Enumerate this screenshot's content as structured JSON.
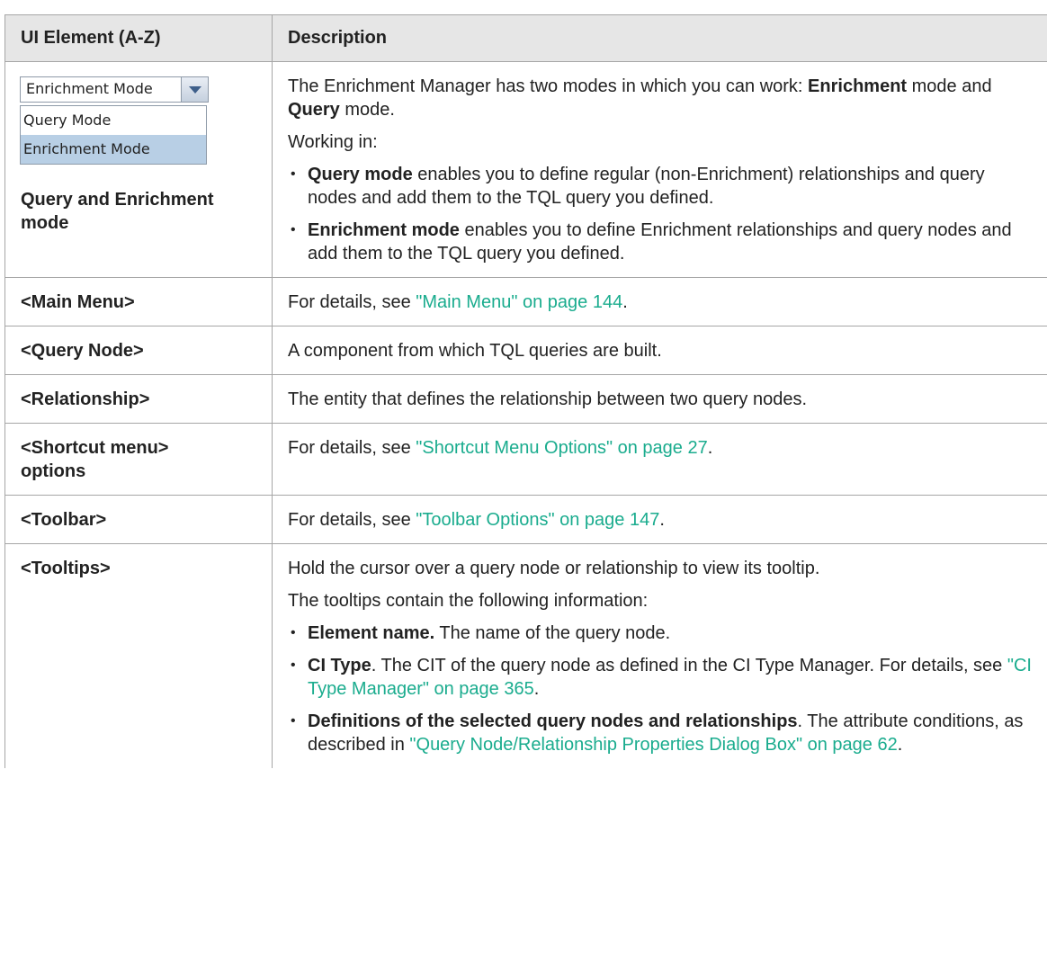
{
  "table": {
    "headers": [
      "UI Element (A-Z)",
      "Description"
    ],
    "dropdown": {
      "selected": "Enrichment Mode",
      "options": [
        "Query Mode",
        "Enrichment Mode"
      ]
    },
    "row1": {
      "name": "Query and Enrichment mode",
      "intro_pre": "The Enrichment Manager has two modes in which you can work: ",
      "intro_b1": "Enrichment",
      "intro_mid": " mode and ",
      "intro_b2": "Query",
      "intro_post": " mode.",
      "working": "Working in:",
      "b1_bold": "Query mode",
      "b1_text": " enables you to define regular (non-Enrichment) relationships and query nodes and add them to the TQL query you defined.",
      "b2_bold": "Enrichment mode",
      "b2_text": " enables you to define Enrichment relationships and query nodes and add them to the TQL query you defined."
    },
    "row_main_menu": {
      "name": "<Main Menu>",
      "pre": "For details, see ",
      "link": "\"Main Menu\" on page 144",
      "post": "."
    },
    "row_query_node": {
      "name": "<Query Node>",
      "desc": "A component from which TQL queries are built."
    },
    "row_relationship": {
      "name": "<Relationship>",
      "desc": "The entity that defines the relationship between two query nodes."
    },
    "row_shortcut": {
      "name_1": "<Shortcut menu>",
      "name_2": "options",
      "pre": "For details, see ",
      "link": "\"Shortcut Menu Options\" on page 27",
      "post": "."
    },
    "row_toolbar": {
      "name": "<Toolbar>",
      "pre": "For details, see ",
      "link": "\"Toolbar Options\" on page 147",
      "post": "."
    },
    "row_tooltips": {
      "name": "<Tooltips>",
      "p1": "Hold the cursor over a query node or relationship to view its tooltip.",
      "p2": "The tooltips contain the following information:",
      "b1_bold": "Element name.",
      "b1_text": " The name of the query node.",
      "b2_bold": "CI Type",
      "b2_text": ". The CIT of the query node as defined in the CI Type Manager. For details, see ",
      "b2_link": "\"CI Type Manager\" on page 365",
      "b2_post": ".",
      "b3_bold": "Definitions of the selected query nodes and relationships",
      "b3_text": ". The attribute conditions, as described in ",
      "b3_link": "\"Query Node/Relationship Properties Dialog Box\" on page 62",
      "b3_post": "."
    },
    "bullet_glyph": "•"
  }
}
